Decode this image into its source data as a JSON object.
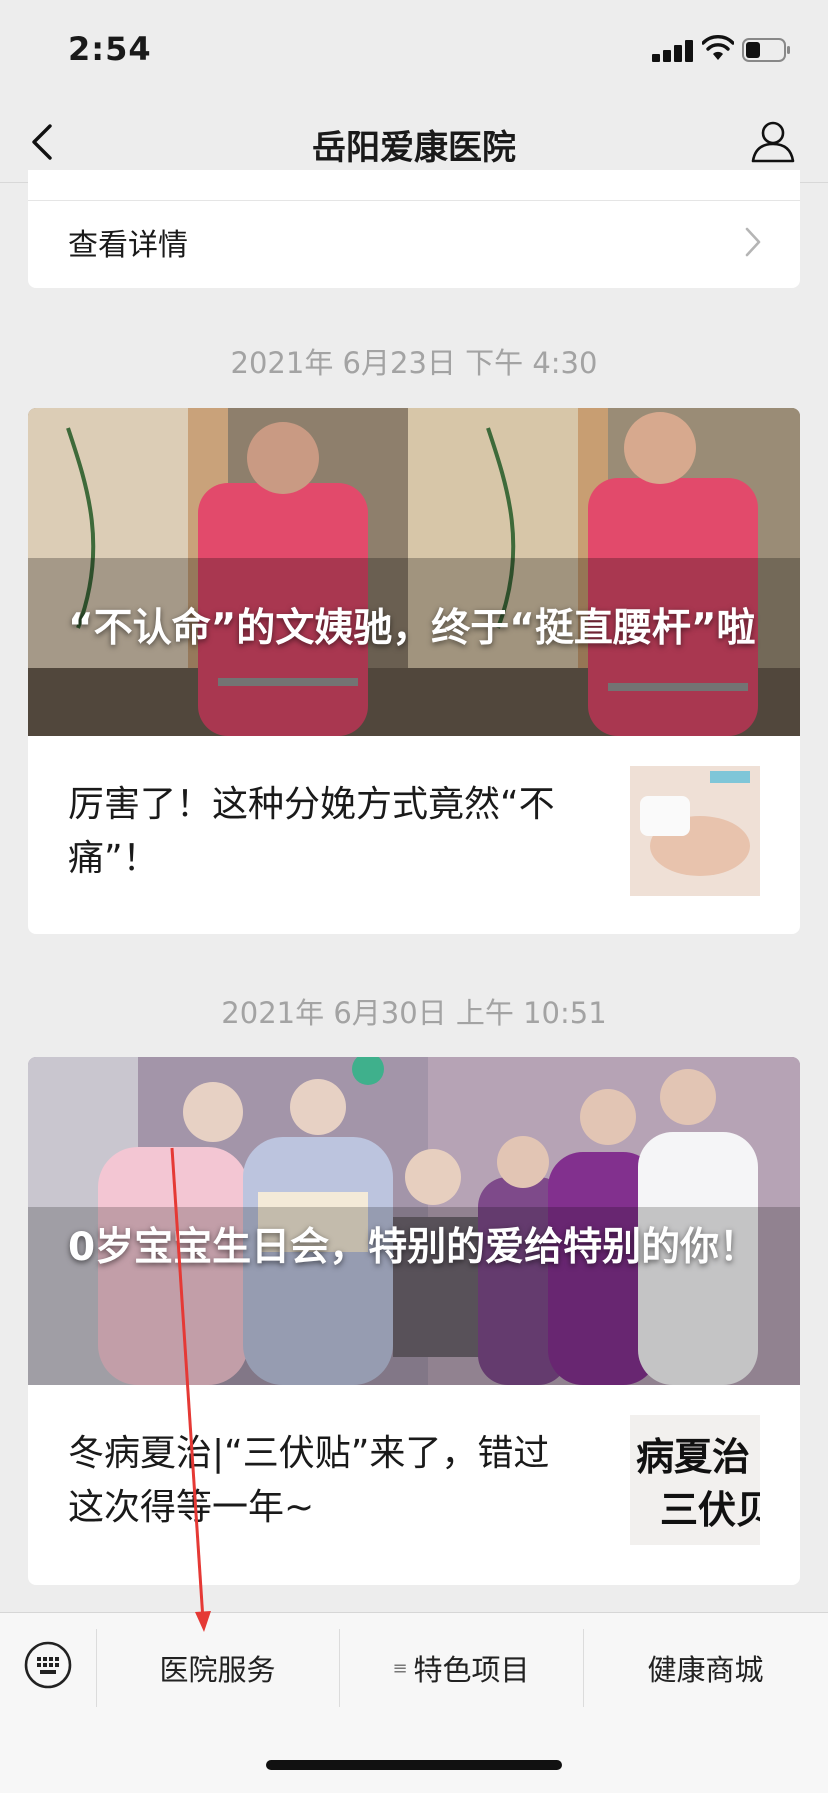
{
  "status_bar": {
    "time": "2:54"
  },
  "nav": {
    "title": "岳阳爱康医院"
  },
  "detail_card": {
    "label": "查看详情"
  },
  "messages": [
    {
      "timestamp": "2021年 6月23日 下午 4:30",
      "hero_title": "“不认命”的文姨驰，终于“挺直腰杆”啦",
      "sub_title": "厉害了！这种分娩方式竟然“不痛”！"
    },
    {
      "timestamp": "2021年 6月30日 上午 10:51",
      "hero_title": "0岁宝宝生日会，特别的爱给特别的你！",
      "sub_title": "冬病夏治|“三伏贴”来了，错过这次得等一年~",
      "thumb_text_line1": "病夏治",
      "thumb_text_line2": "三伏贝"
    }
  ],
  "bottom_menu": {
    "items": [
      {
        "label": "医院服务"
      },
      {
        "label": "特色项目",
        "icon": "submenu-icon"
      },
      {
        "label": "健康商城"
      }
    ]
  },
  "colors": {
    "background": "#ededed",
    "annotation_arrow": "#e53935"
  }
}
